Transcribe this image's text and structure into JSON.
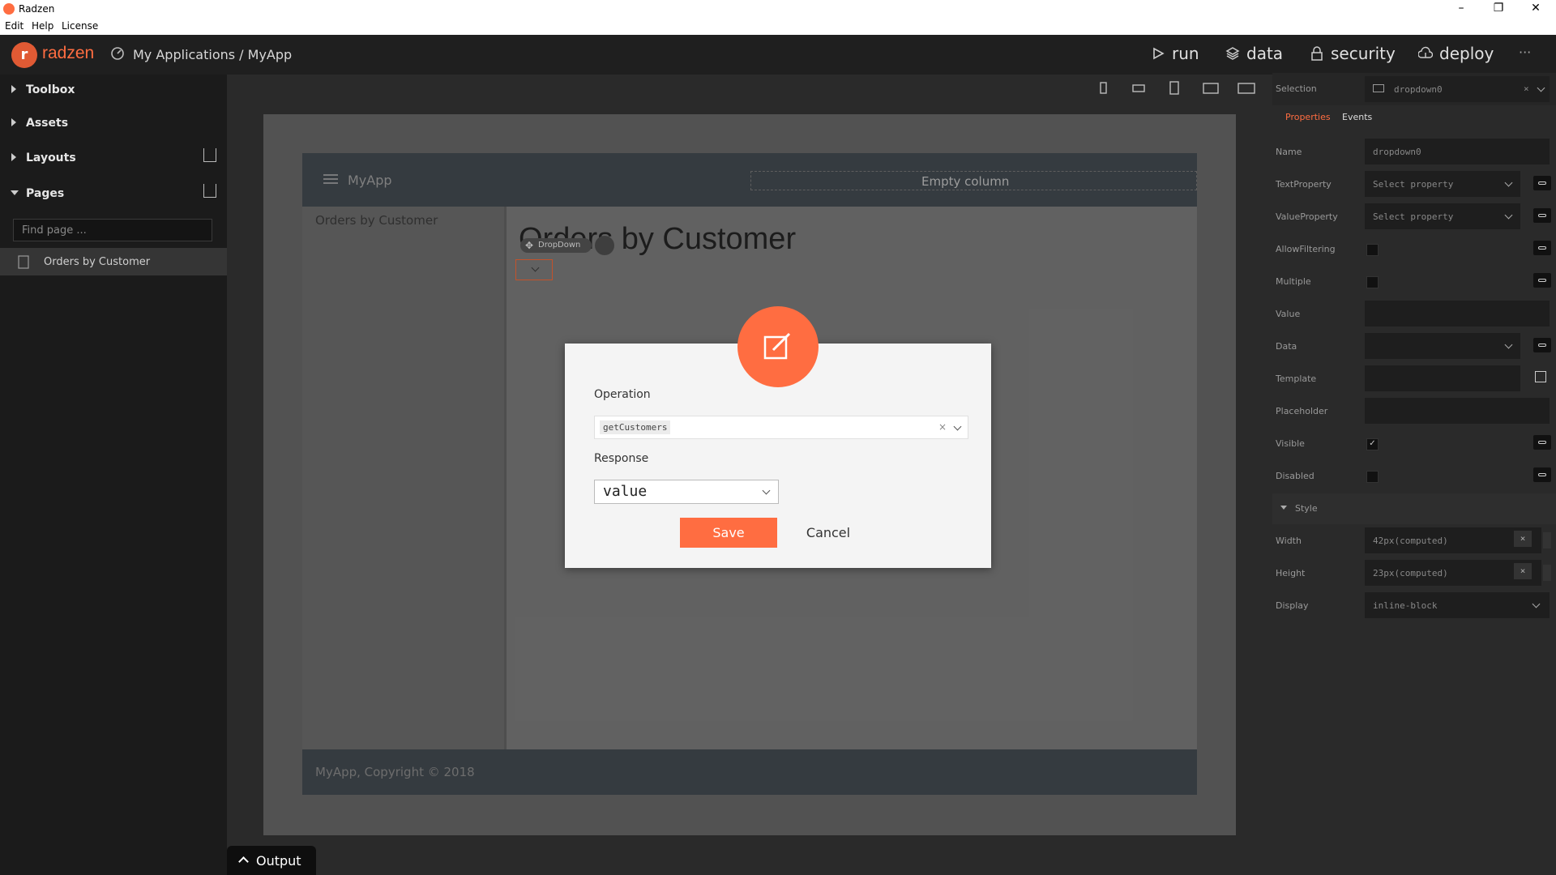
{
  "window": {
    "title": "Radzen",
    "menu": [
      "Edit",
      "Help",
      "License"
    ]
  },
  "header": {
    "brand": "radzen",
    "breadcrumb": "My Applications / MyApp",
    "nav": [
      "run",
      "data",
      "security",
      "deploy"
    ],
    "more": "···"
  },
  "sidebar": {
    "items": [
      {
        "label": "Toolbox",
        "expanded": false
      },
      {
        "label": "Assets",
        "expanded": false
      },
      {
        "label": "Layouts",
        "expanded": false
      },
      {
        "label": "Pages",
        "expanded": true
      }
    ],
    "find_placeholder": "Find page ...",
    "pages": [
      "Orders by Customer"
    ]
  },
  "canvas": {
    "app_name": "MyApp",
    "empty_column": "Empty column",
    "nav_link": "Orders by Customer",
    "heading": "Orders by Customer",
    "component_tag": "DropDown",
    "footer": "MyApp, Copyright © 2018"
  },
  "dialog": {
    "operation_label": "Operation",
    "operation_value": "getCustomers",
    "clear_symbol": "×",
    "response_label": "Response",
    "response_value": "value",
    "save_label": "Save",
    "cancel_label": "Cancel"
  },
  "properties": {
    "selection_label": "Selection",
    "selection_value": "dropdown0",
    "tabs": [
      "Properties",
      "Events"
    ],
    "rows": [
      {
        "label": "Name",
        "value": "dropdown0"
      },
      {
        "label": "TextProperty",
        "value": "Select property"
      },
      {
        "label": "ValueProperty",
        "value": "Select property"
      },
      {
        "label": "AllowFiltering",
        "value": ""
      },
      {
        "label": "Multiple",
        "value": ""
      },
      {
        "label": "Value",
        "value": ""
      },
      {
        "label": "Data",
        "value": ""
      },
      {
        "label": "Template",
        "value": ""
      },
      {
        "label": "Placeholder",
        "value": ""
      },
      {
        "label": "Visible",
        "value": "✓"
      },
      {
        "label": "Disabled",
        "value": ""
      }
    ],
    "style_section": "Style",
    "style_rows": [
      {
        "label": "Width",
        "value": "42px(computed)"
      },
      {
        "label": "Height",
        "value": "23px(computed)"
      },
      {
        "label": "Display",
        "value": "inline-block"
      }
    ]
  },
  "output": {
    "label": "Output"
  },
  "colors": {
    "accent": "#ff6d41",
    "panel": "#2a2a2a",
    "sidebar": "#1b1b1b"
  }
}
